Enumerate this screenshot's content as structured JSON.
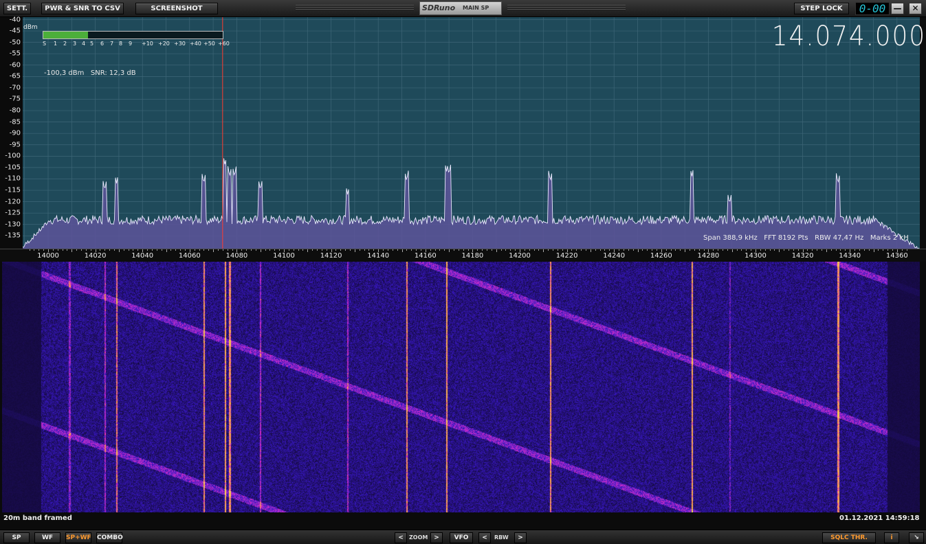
{
  "toolbar": {
    "settings": "SETT.",
    "pwr_snr_csv": "PWR & SNR TO CSV",
    "screenshot": "SCREENSHOT",
    "step_lock": "STEP LOCK",
    "vfo_display": "0-00",
    "minimize": "—",
    "close": "✕"
  },
  "window": {
    "app_title": "SDRuno",
    "panel_title": "MAIN SP"
  },
  "spectrum": {
    "dbm_unit": "dBm",
    "db_labels": [
      "-40",
      "-45",
      "-50",
      "-55",
      "-60",
      "-65",
      "-70",
      "-75",
      "-80",
      "-85",
      "-90",
      "-95",
      "-100",
      "-105",
      "-110",
      "-115",
      "-120",
      "-125",
      "-130",
      "-135"
    ],
    "s_meter_scale": [
      "S",
      "1",
      "2",
      "3",
      "4",
      "5",
      "6",
      "7",
      "8",
      "9",
      "+10",
      "+20",
      "+30",
      "+40",
      "+50",
      "+60"
    ],
    "s_meter_level": 0.25,
    "signal_readout": "-100,3 dBm   SNR: 12,3 dB",
    "frequency": "14.074.000",
    "info": "Span 388,9 kHz   FFT 8192 Pts   RBW 47,47 Hz   Marks 2 kH",
    "freq_labels": [
      "14000",
      "14020",
      "14040",
      "14060",
      "14080",
      "14100",
      "14120",
      "14140",
      "14160",
      "14180",
      "14200",
      "14220",
      "14240",
      "14260",
      "14280",
      "14300",
      "14320",
      "14340",
      "14360"
    ],
    "colors": {
      "background": "#1f4a5a",
      "grid": "#3e6677",
      "trace_fill": "#5d549a",
      "trace_line": "#ecebff",
      "tune_marker": "#ff3b30"
    }
  },
  "waterfall": {
    "caption": "20m band framed",
    "timestamp": "01.12.2021 14:59:18"
  },
  "bottombar": {
    "sp": "SP",
    "wf": "WF",
    "spwf": "SP+WF",
    "combo": "COMBO",
    "zoom_prev": "<",
    "zoom_label": "ZOOM",
    "zoom_next": ">",
    "vfo": "VFO",
    "rbw_prev": "<",
    "rbw_label": "RBW",
    "rbw_next": ">",
    "sqlc_thr": "SQLC THR.",
    "info": "i",
    "resize": "↘"
  }
}
